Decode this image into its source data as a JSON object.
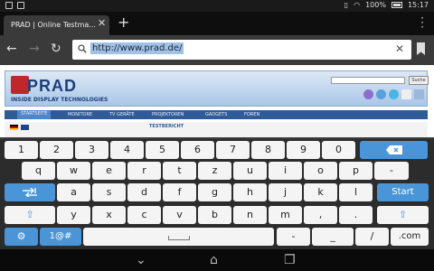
{
  "status_bar": {
    "battery": "100%",
    "time": "15:17"
  },
  "browser": {
    "tab_title": "PRAD | Online Testma...",
    "url": "http://www.prad.de/",
    "icons": {
      "back": "back-arrow-icon",
      "forward": "forward-arrow-icon",
      "reload": "reload-icon",
      "search": "search-icon",
      "clear": "close-icon",
      "bookmark": "bookmark-icon",
      "menu": "overflow-menu-icon",
      "new_tab": "plus-icon"
    }
  },
  "website": {
    "logo": "PRAD",
    "tagline": "INSIDE DISPLAY TECHNOLOGIES",
    "search_button": "Suche",
    "nav": [
      "STARTSEITE",
      "MONITORE",
      "TV GERÄTE",
      "PROJEKTOREN",
      "GADGETS",
      "FOREN"
    ],
    "row_label": "TESTBERICHT"
  },
  "keyboard": {
    "row1": [
      "1",
      "2",
      "3",
      "4",
      "5",
      "6",
      "7",
      "8",
      "9",
      "0"
    ],
    "row2": [
      "q",
      "w",
      "e",
      "r",
      "t",
      "z",
      "u",
      "i",
      "o",
      "p",
      "-"
    ],
    "row3": [
      "a",
      "s",
      "d",
      "f",
      "g",
      "h",
      "j",
      "k",
      "l"
    ],
    "row4": [
      "y",
      "x",
      "c",
      "v",
      "b",
      "n",
      "m",
      ",",
      "."
    ],
    "start_label": "Start",
    "symbols_label": "1@#",
    "dash_label": "-",
    "underscore_label": "_",
    "slash_label": "/",
    "dotcom_label": ".com",
    "accent_color": "#4a95d8"
  }
}
